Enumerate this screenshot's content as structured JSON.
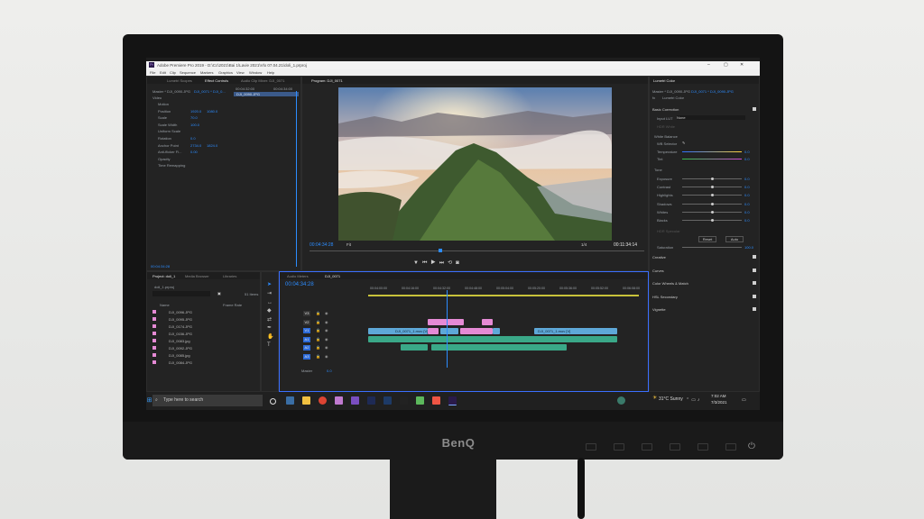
{
  "monitor": {
    "brand": "BenQ"
  },
  "app": {
    "title": "Adobe Premiere Pro 2019 - D:\\Cc\\2021\\Bai 1\\Lavie 2021\\Vlo 07.04.21\\doli_1.prproj",
    "menus": [
      "File",
      "Edit",
      "Clip",
      "Sequence",
      "Markers",
      "Graphics",
      "View",
      "Window",
      "Help"
    ],
    "window_controls": [
      "–",
      "▢",
      "✕"
    ]
  },
  "effect_controls": {
    "tabs": [
      "Lumetri Scopes",
      "Effect Controls",
      "Audio Clip Mixer: DJI_0071"
    ],
    "master_label": "Master * DJI_0090.JPG",
    "clip_label": "DJI_0071 * DJI_0...",
    "section_video": "Video",
    "rows": [
      {
        "label": "Motion",
        "value": "",
        "value2": ""
      },
      {
        "label": "Position",
        "value": "1920.0",
        "value2": "1080.0"
      },
      {
        "label": "Scale",
        "value": "70.0",
        "value2": ""
      },
      {
        "label": "Scale Width",
        "value": "100.0",
        "value2": ""
      },
      {
        "label": "Uniform Scale",
        "value": "",
        "value2": ""
      },
      {
        "label": "Rotation",
        "value": "0.0",
        "value2": ""
      },
      {
        "label": "Anchor Point",
        "value": "2734.0",
        "value2": "1824.0"
      },
      {
        "label": "Anti-flicker Fi...",
        "value": "0.00",
        "value2": ""
      },
      {
        "label": "Opacity",
        "value": "",
        "value2": ""
      },
      {
        "label": "Time Remapping",
        "value": "",
        "value2": ""
      }
    ],
    "mini_timecodes": [
      "00:04:32:00",
      "00:04:34:00"
    ],
    "mini_clip": "DJI_0090.JPG",
    "timecode": "00:04:34:28"
  },
  "program": {
    "tab": "Program: DJI_0071",
    "timecode": "00:04:34:28",
    "fit": "Fit",
    "ratio": "1/4",
    "duration": "00:11:34:14"
  },
  "lumetri": {
    "tab": "Lumetri Color",
    "master": "Master * DJI_0090.JPG",
    "clip": "DJI_0071 * DJI_0090.JPG",
    "fx": "fx",
    "lumetri_label": "Lumetri Color",
    "basic": "Basic Correction",
    "input_lut_label": "Input LUT",
    "input_lut_value": "None",
    "hdr_white": "HDR White",
    "white_balance": "White Balance",
    "wb_selector": "WB Selector",
    "temperature": "Temperature",
    "temperature_value": "0.0",
    "tint": "Tint",
    "tint_value": "0.0",
    "tone": "Tone",
    "tone_rows": [
      {
        "label": "Exposure",
        "value": "0.0"
      },
      {
        "label": "Contrast",
        "value": "0.0"
      },
      {
        "label": "Highlights",
        "value": "0.0"
      },
      {
        "label": "Shadows",
        "value": "0.0"
      },
      {
        "label": "Whites",
        "value": "0.0"
      },
      {
        "label": "Blacks",
        "value": "0.0"
      }
    ],
    "hdr_specular": "HDR Specular",
    "reset": "Reset",
    "auto": "Auto",
    "saturation": "Saturation",
    "saturation_value": "100.0",
    "sections": [
      "Creative",
      "Curves",
      "Color Wheels & Match",
      "HSL Secondary",
      "Vignette"
    ]
  },
  "project": {
    "tabs": [
      "Project: doli_1",
      "Media Browser",
      "Libraries"
    ],
    "file": "doli_1.prproj",
    "items_count": "51 Items",
    "col_name": "Name",
    "col_rate": "Frame Rate",
    "items": [
      "DJI_0096.JPG",
      "DJI_0095.JPG",
      "DJI_0174.JPG",
      "DJI_0156.JPG",
      "DJI_0083.jpg",
      "DJI_0092.JPG",
      "DJI_0085.jpg",
      "DJI_0084.JPG"
    ]
  },
  "timeline": {
    "tabs": [
      "Audio Meters",
      "DJI_0071"
    ],
    "timecode": "00:04:34:28",
    "ruler": [
      "00:04:00:00",
      "00:04:16:00",
      "00:04:32:00",
      "00:04:48:00",
      "00:05:04:00",
      "00:05:20:00",
      "00:05:36:00",
      "00:05:52:00",
      "00:06:08:00"
    ],
    "tracks": [
      "V3",
      "V2",
      "V1",
      "A1",
      "A2",
      "A3"
    ],
    "master": "Master",
    "master_value": "0.0",
    "clip_v1_a": "DJI_0071_1.mov [V]",
    "clip_v1_b": "DJI_0071_1.mov [V]"
  },
  "taskbar": {
    "search_placeholder": "Type here to search",
    "weather": "31°C  Sunny",
    "time": "7:02 AM",
    "date": "7/3/2021"
  },
  "colors": {
    "accent": "#2c8cff",
    "clip_video": "#5ea8d8",
    "clip_audio": "#3aa888",
    "clip_graphic": "#e58ad5",
    "timeline_border": "#3a6fff"
  }
}
